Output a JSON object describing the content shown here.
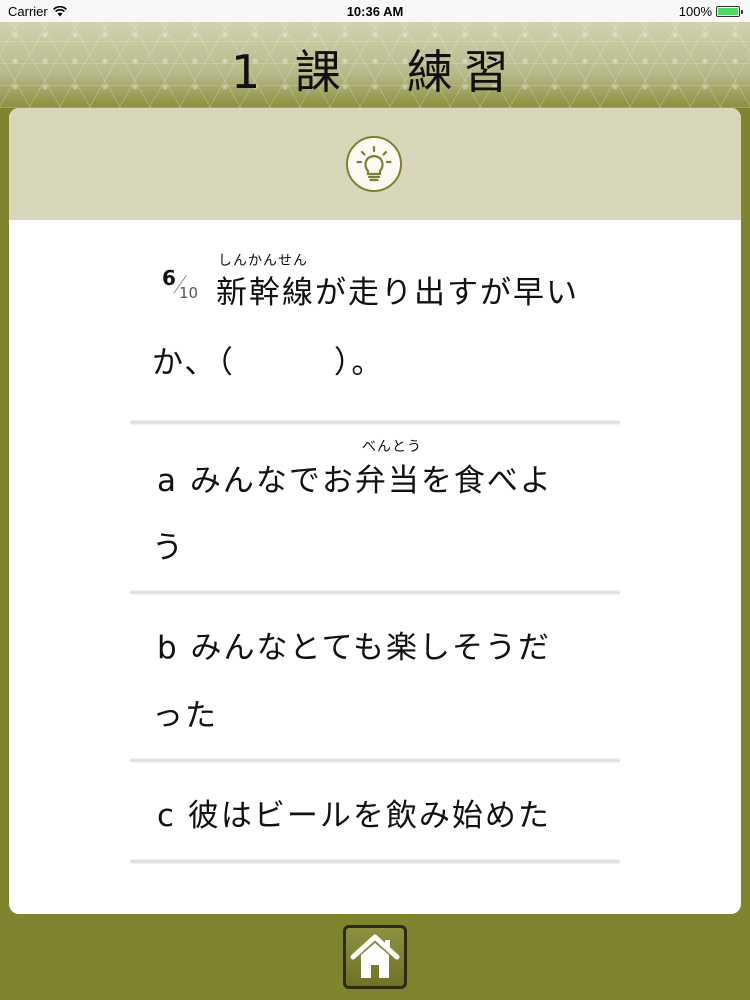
{
  "status_bar": {
    "carrier": "Carrier",
    "time": "10:36 AM",
    "battery": "100%",
    "battery_level": 1.0,
    "wifi_icon": "wifi-icon"
  },
  "header": {
    "title": "1 課　練習"
  },
  "hint": {
    "icon": "lightbulb-icon"
  },
  "question": {
    "counter_current": "6",
    "counter_total": "10",
    "ruby_1": "しんかんせん",
    "line_1": "新幹線が走り出すが早い",
    "line_2": "か、（　　　）。"
  },
  "options": [
    {
      "letter": "a",
      "ruby": "べんとう",
      "line_1": "a  みんなでお弁当を食べよ",
      "line_2": "う"
    },
    {
      "letter": "b",
      "line_1": "b  みんなとても楽しそうだ",
      "line_2": "った"
    },
    {
      "letter": "c",
      "line_1": "c  彼はビールを飲み始めた"
    }
  ],
  "footer": {
    "home_icon": "home-icon"
  },
  "colors": {
    "accent_olive": "#7f842e",
    "card_header": "#d8d6b8",
    "battery_green": "#4cd964"
  }
}
